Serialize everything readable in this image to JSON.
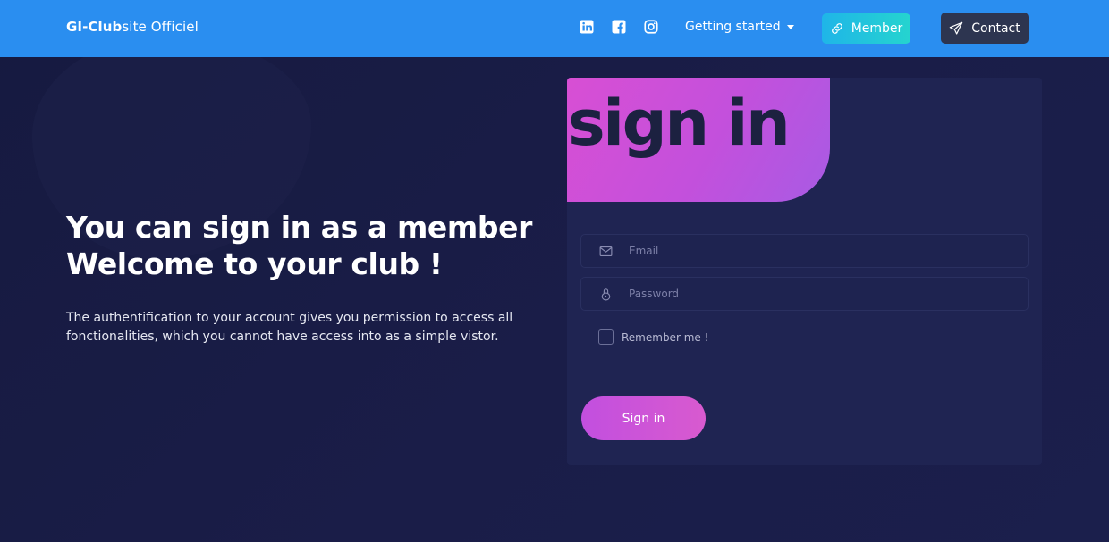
{
  "navbar": {
    "brand_bold": "GI-Club",
    "brand_rest": "site Officiel",
    "social": [
      "linkedin-icon",
      "facebook-icon",
      "instagram-icon"
    ],
    "getting_started": "Getting started",
    "member_label": "Member",
    "contact_label": "Contact"
  },
  "hero": {
    "title_line1": "You can sign in as a member",
    "title_line2": "Welcome to your club !",
    "description": "The authentification to your account gives you permission to access all fonctionalities, which you cannot have access into as a simple vistor."
  },
  "card": {
    "title": "sign in",
    "email_placeholder": "Email",
    "password_placeholder": "Password",
    "remember_label": "Remember me !",
    "submit_label": "Sign in"
  },
  "colors": {
    "navbar": "#2a8ef0",
    "background": "#181b44",
    "card": "#1f2452",
    "accent_gradient_start": "#d84fd4",
    "accent_gradient_end": "#a85be4",
    "member_button": "#1fb5e8",
    "contact_button": "#2d3550"
  }
}
